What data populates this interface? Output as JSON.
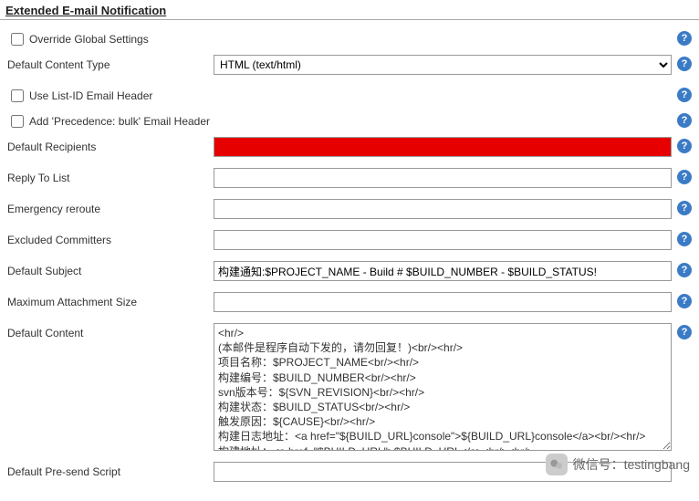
{
  "section": {
    "title": "Extended E-mail Notification"
  },
  "fields": {
    "override_global": {
      "label": "Override Global Settings",
      "checked": false
    },
    "content_type": {
      "label": "Default Content Type",
      "value": "HTML (text/html)",
      "options": [
        "HTML (text/html)"
      ]
    },
    "use_list_id": {
      "label": "Use List-ID Email Header",
      "checked": false
    },
    "precedence_bulk": {
      "label": "Add 'Precedence: bulk' Email Header",
      "checked": false
    },
    "default_recipients": {
      "label": "Default Recipients",
      "value": ""
    },
    "reply_to": {
      "label": "Reply To List",
      "value": ""
    },
    "emergency_reroute": {
      "label": "Emergency reroute",
      "value": ""
    },
    "excluded_committers": {
      "label": "Excluded Committers",
      "value": ""
    },
    "default_subject": {
      "label": "Default Subject",
      "value": "构建通知:$PROJECT_NAME - Build # $BUILD_NUMBER - $BUILD_STATUS!"
    },
    "max_attach": {
      "label": "Maximum Attachment Size",
      "value": ""
    },
    "default_content": {
      "label": "Default Content",
      "value": "<hr/>\n(本邮件是程序自动下发的，请勿回复！)<br/><hr/>\n项目名称：$PROJECT_NAME<br/><hr/>\n构建编号：$BUILD_NUMBER<br/><hr/>\nsvn版本号：${SVN_REVISION}<br/><hr/>\n构建状态：$BUILD_STATUS<br/><hr/>\n触发原因：${CAUSE}<br/><hr/>\n构建日志地址：<a href=\"${BUILD_URL}console\">${BUILD_URL}console</a><br/><hr/>\n构建地址：<a href=\"$BUILD_URL\">$BUILD_URL</a><br/><hr/>"
    },
    "pre_send": {
      "label": "Default Pre-send Script",
      "value": ""
    }
  },
  "help_tooltip": "?",
  "watermark": {
    "label": "微信号：testingbang"
  }
}
